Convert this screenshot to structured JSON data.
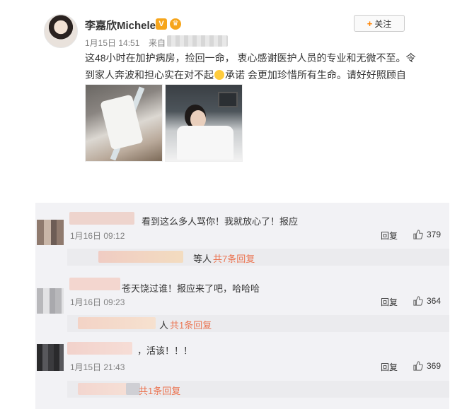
{
  "post": {
    "username": "李嘉欣Michele",
    "vip_badge": "V",
    "crown": "♛",
    "time": "1月15日 14:51",
    "source_prefix": "来自",
    "follow_label": "关注",
    "follow_icon": "+",
    "text_part1": "这48小时在加护病房，捡回一命， 衷心感谢医护人员的专业和无微不至。令到家人奔波和担心实在对不起",
    "text_part2": "承诺 会更加珍惜所有生命。请好好照顾自己。",
    "emoji_icon": "crying-face-emoji",
    "photos": [
      "hospital-bandaged-arm-photo",
      "hospital-bed-patient-photo"
    ]
  },
  "comments": [
    {
      "text": "看到这么多人骂你！我就放心了！报应",
      "time": "1月16日 09:12",
      "reply_label": "回复",
      "likes": "379",
      "sub": {
        "name": "等人",
        "total": "共7条回复"
      }
    },
    {
      "text": "苍天饶过谁！报应来了吧，哈哈哈",
      "time": "1月16日 09:23",
      "reply_label": "回复",
      "likes": "364",
      "sub": {
        "name": "人",
        "total": "共1条回复"
      }
    },
    {
      "text": "，活该！！！",
      "time": "1月15日 21:43",
      "reply_label": "回复",
      "likes": "369",
      "sub": {
        "name": "",
        "total": "共1条回复"
      }
    }
  ],
  "colors": {
    "accent_orange": "#ff8200",
    "reply_link": "#eb7350",
    "comment_bg": "#f2f2f5",
    "vip_gold": "#f6a51b"
  }
}
